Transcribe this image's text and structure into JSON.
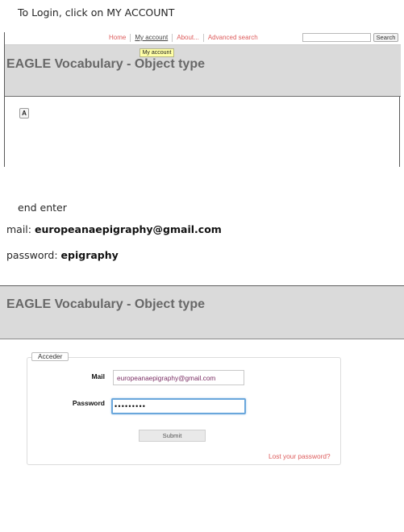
{
  "instructions": {
    "step_1": "To Login, click on MY ACCOUNT",
    "step_2": "end enter",
    "mail_label": "mail:",
    "mail_value": "europeanaepigraphy@gmail.com",
    "password_label": "password:",
    "password_value": "epigraphy"
  },
  "screenshot_1": {
    "nav": {
      "items": [
        {
          "label": "Home",
          "active": false
        },
        {
          "label": "My account",
          "active": true
        },
        {
          "label": "About...",
          "active": false
        },
        {
          "label": "Advanced search",
          "active": false
        }
      ],
      "search_button": "Search"
    },
    "tooltip": "My account",
    "header_title": "EAGLE Vocabulary - Object type",
    "alphabet_index": [
      "A"
    ]
  },
  "screenshot_2": {
    "header_title": "EAGLE Vocabulary - Object type",
    "login_form": {
      "legend": "Acceder",
      "mail_label": "Mail",
      "mail_value": "europeanaepigraphy@gmail.com",
      "password_label": "Password",
      "password_value": "•••••••••",
      "password_focused": true,
      "submit_label": "Submit",
      "lost_password_link": "Lost your password?"
    }
  },
  "colors": {
    "link": "#dd5c5c",
    "active_link": "#444444",
    "header_band": "#dadada",
    "header_title": "#686868",
    "tooltip_bg": "#ffffa6",
    "mail_value_text": "#7a2e63",
    "focus_border": "#6aa7dc"
  }
}
